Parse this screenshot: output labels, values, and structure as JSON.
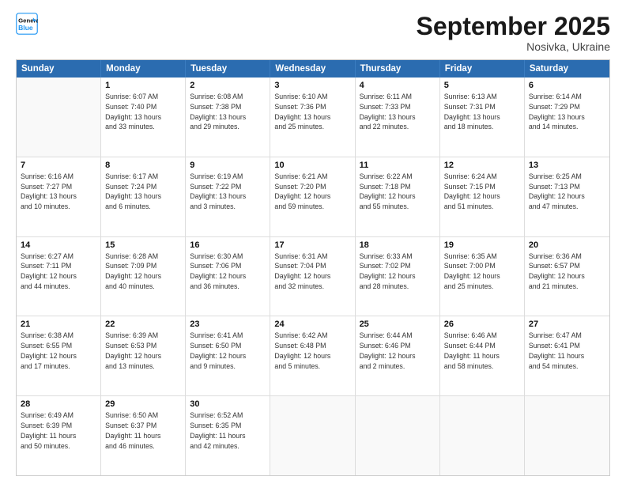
{
  "header": {
    "logo_line1": "General",
    "logo_line2": "Blue",
    "month": "September 2025",
    "location": "Nosivka, Ukraine"
  },
  "weekdays": [
    "Sunday",
    "Monday",
    "Tuesday",
    "Wednesday",
    "Thursday",
    "Friday",
    "Saturday"
  ],
  "rows": [
    [
      {
        "day": "",
        "info": []
      },
      {
        "day": "1",
        "info": [
          "Sunrise: 6:07 AM",
          "Sunset: 7:40 PM",
          "Daylight: 13 hours",
          "and 33 minutes."
        ]
      },
      {
        "day": "2",
        "info": [
          "Sunrise: 6:08 AM",
          "Sunset: 7:38 PM",
          "Daylight: 13 hours",
          "and 29 minutes."
        ]
      },
      {
        "day": "3",
        "info": [
          "Sunrise: 6:10 AM",
          "Sunset: 7:36 PM",
          "Daylight: 13 hours",
          "and 25 minutes."
        ]
      },
      {
        "day": "4",
        "info": [
          "Sunrise: 6:11 AM",
          "Sunset: 7:33 PM",
          "Daylight: 13 hours",
          "and 22 minutes."
        ]
      },
      {
        "day": "5",
        "info": [
          "Sunrise: 6:13 AM",
          "Sunset: 7:31 PM",
          "Daylight: 13 hours",
          "and 18 minutes."
        ]
      },
      {
        "day": "6",
        "info": [
          "Sunrise: 6:14 AM",
          "Sunset: 7:29 PM",
          "Daylight: 13 hours",
          "and 14 minutes."
        ]
      }
    ],
    [
      {
        "day": "7",
        "info": [
          "Sunrise: 6:16 AM",
          "Sunset: 7:27 PM",
          "Daylight: 13 hours",
          "and 10 minutes."
        ]
      },
      {
        "day": "8",
        "info": [
          "Sunrise: 6:17 AM",
          "Sunset: 7:24 PM",
          "Daylight: 13 hours",
          "and 6 minutes."
        ]
      },
      {
        "day": "9",
        "info": [
          "Sunrise: 6:19 AM",
          "Sunset: 7:22 PM",
          "Daylight: 13 hours",
          "and 3 minutes."
        ]
      },
      {
        "day": "10",
        "info": [
          "Sunrise: 6:21 AM",
          "Sunset: 7:20 PM",
          "Daylight: 12 hours",
          "and 59 minutes."
        ]
      },
      {
        "day": "11",
        "info": [
          "Sunrise: 6:22 AM",
          "Sunset: 7:18 PM",
          "Daylight: 12 hours",
          "and 55 minutes."
        ]
      },
      {
        "day": "12",
        "info": [
          "Sunrise: 6:24 AM",
          "Sunset: 7:15 PM",
          "Daylight: 12 hours",
          "and 51 minutes."
        ]
      },
      {
        "day": "13",
        "info": [
          "Sunrise: 6:25 AM",
          "Sunset: 7:13 PM",
          "Daylight: 12 hours",
          "and 47 minutes."
        ]
      }
    ],
    [
      {
        "day": "14",
        "info": [
          "Sunrise: 6:27 AM",
          "Sunset: 7:11 PM",
          "Daylight: 12 hours",
          "and 44 minutes."
        ]
      },
      {
        "day": "15",
        "info": [
          "Sunrise: 6:28 AM",
          "Sunset: 7:09 PM",
          "Daylight: 12 hours",
          "and 40 minutes."
        ]
      },
      {
        "day": "16",
        "info": [
          "Sunrise: 6:30 AM",
          "Sunset: 7:06 PM",
          "Daylight: 12 hours",
          "and 36 minutes."
        ]
      },
      {
        "day": "17",
        "info": [
          "Sunrise: 6:31 AM",
          "Sunset: 7:04 PM",
          "Daylight: 12 hours",
          "and 32 minutes."
        ]
      },
      {
        "day": "18",
        "info": [
          "Sunrise: 6:33 AM",
          "Sunset: 7:02 PM",
          "Daylight: 12 hours",
          "and 28 minutes."
        ]
      },
      {
        "day": "19",
        "info": [
          "Sunrise: 6:35 AM",
          "Sunset: 7:00 PM",
          "Daylight: 12 hours",
          "and 25 minutes."
        ]
      },
      {
        "day": "20",
        "info": [
          "Sunrise: 6:36 AM",
          "Sunset: 6:57 PM",
          "Daylight: 12 hours",
          "and 21 minutes."
        ]
      }
    ],
    [
      {
        "day": "21",
        "info": [
          "Sunrise: 6:38 AM",
          "Sunset: 6:55 PM",
          "Daylight: 12 hours",
          "and 17 minutes."
        ]
      },
      {
        "day": "22",
        "info": [
          "Sunrise: 6:39 AM",
          "Sunset: 6:53 PM",
          "Daylight: 12 hours",
          "and 13 minutes."
        ]
      },
      {
        "day": "23",
        "info": [
          "Sunrise: 6:41 AM",
          "Sunset: 6:50 PM",
          "Daylight: 12 hours",
          "and 9 minutes."
        ]
      },
      {
        "day": "24",
        "info": [
          "Sunrise: 6:42 AM",
          "Sunset: 6:48 PM",
          "Daylight: 12 hours",
          "and 5 minutes."
        ]
      },
      {
        "day": "25",
        "info": [
          "Sunrise: 6:44 AM",
          "Sunset: 6:46 PM",
          "Daylight: 12 hours",
          "and 2 minutes."
        ]
      },
      {
        "day": "26",
        "info": [
          "Sunrise: 6:46 AM",
          "Sunset: 6:44 PM",
          "Daylight: 11 hours",
          "and 58 minutes."
        ]
      },
      {
        "day": "27",
        "info": [
          "Sunrise: 6:47 AM",
          "Sunset: 6:41 PM",
          "Daylight: 11 hours",
          "and 54 minutes."
        ]
      }
    ],
    [
      {
        "day": "28",
        "info": [
          "Sunrise: 6:49 AM",
          "Sunset: 6:39 PM",
          "Daylight: 11 hours",
          "and 50 minutes."
        ]
      },
      {
        "day": "29",
        "info": [
          "Sunrise: 6:50 AM",
          "Sunset: 6:37 PM",
          "Daylight: 11 hours",
          "and 46 minutes."
        ]
      },
      {
        "day": "30",
        "info": [
          "Sunrise: 6:52 AM",
          "Sunset: 6:35 PM",
          "Daylight: 11 hours",
          "and 42 minutes."
        ]
      },
      {
        "day": "",
        "info": []
      },
      {
        "day": "",
        "info": []
      },
      {
        "day": "",
        "info": []
      },
      {
        "day": "",
        "info": []
      }
    ]
  ]
}
